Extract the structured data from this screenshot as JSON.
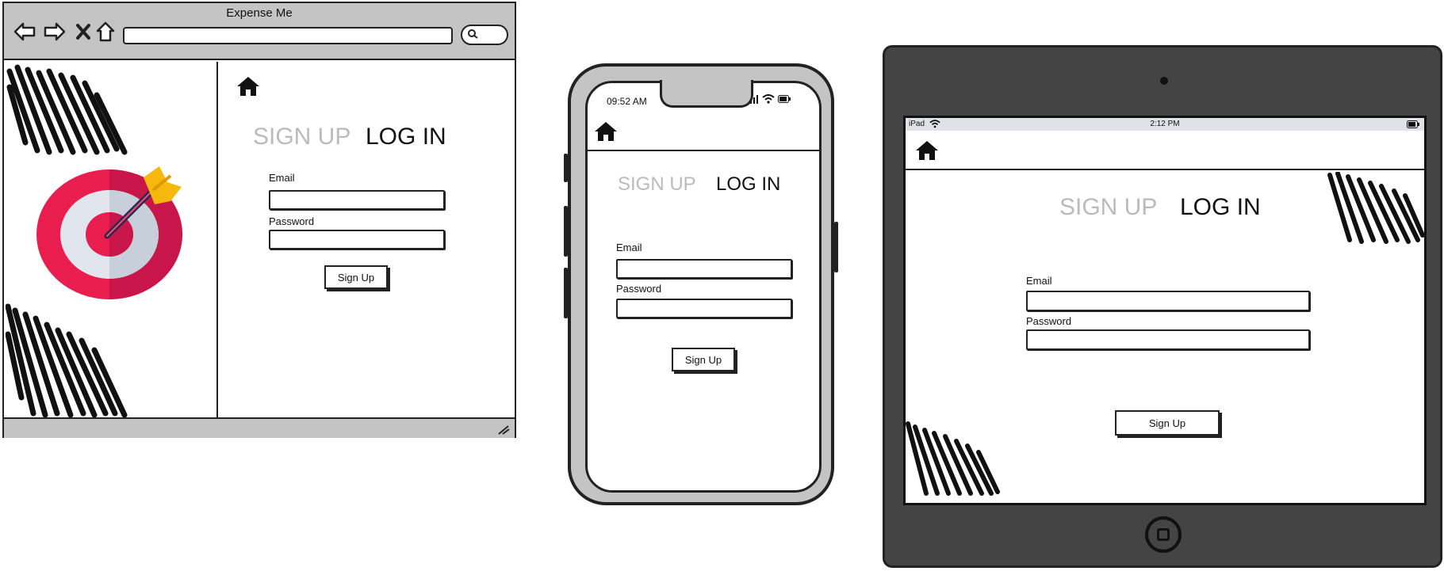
{
  "browser": {
    "title": "Expense Me",
    "auth": {
      "signup_tab": "SIGN UP",
      "login_tab": "LOG IN",
      "email_label": "Email",
      "password_label": "Password",
      "submit_label": "Sign Up"
    }
  },
  "phone": {
    "time": "09:52 AM",
    "auth": {
      "signup_tab": "SIGN UP",
      "login_tab": "LOG IN",
      "email_label": "Email",
      "password_label": "Password",
      "submit_label": "Sign Up"
    }
  },
  "tablet": {
    "device": "iPad",
    "time": "2:12 PM",
    "auth": {
      "signup_tab": "SIGN UP",
      "login_tab": "LOG IN",
      "email_label": "Email",
      "password_label": "Password",
      "submit_label": "Sign Up"
    }
  },
  "colors": {
    "chrome_gray": "#c4c4c4",
    "tablet_body": "#444444",
    "inactive_tab": "#bbbbbb",
    "target_red": "#e91e4f",
    "target_light": "#d9dfe8",
    "arrow_yellow": "#f5b80c"
  },
  "icons": [
    "back-icon",
    "forward-icon",
    "close-icon",
    "home-icon",
    "search-icon",
    "resize-grip-icon",
    "target-icon",
    "signal-icon",
    "wifi-icon",
    "battery-icon"
  ]
}
